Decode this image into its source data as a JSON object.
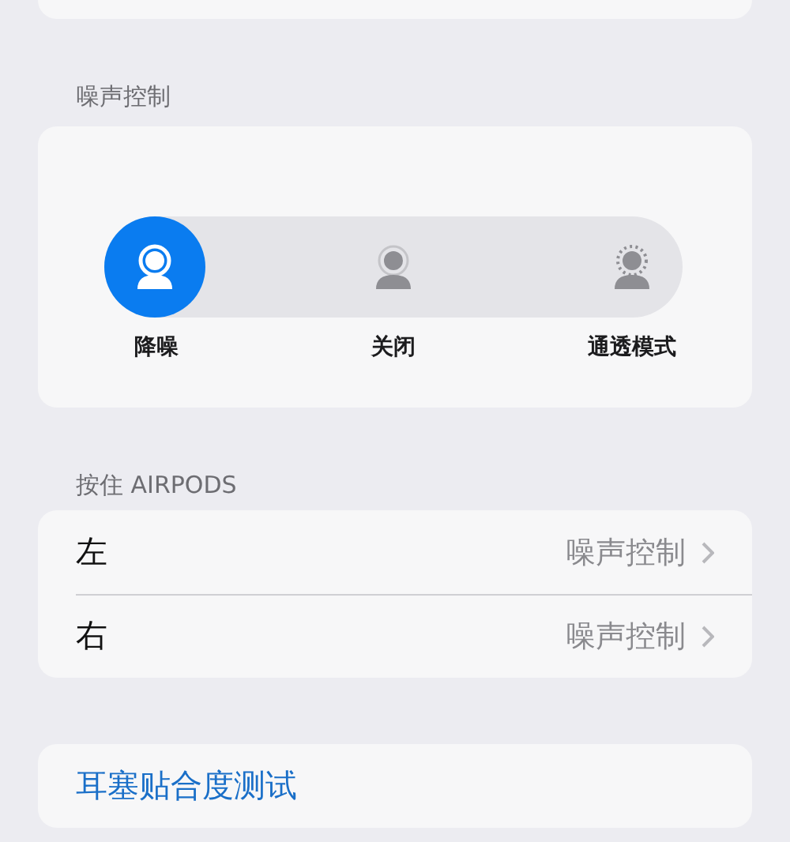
{
  "noise_control": {
    "header": "噪声控制",
    "modes": [
      {
        "kind": "cancel",
        "label": "降噪",
        "selected": true
      },
      {
        "kind": "off",
        "label": "关闭",
        "selected": false
      },
      {
        "kind": "transparency",
        "label": "通透模式",
        "selected": false
      }
    ]
  },
  "press_and_hold": {
    "header": "按住 AIRPODS",
    "rows": [
      {
        "label": "左",
        "value": "噪声控制"
      },
      {
        "label": "右",
        "value": "噪声控制"
      }
    ]
  },
  "fit_test": {
    "label": "耳塞贴合度测试"
  }
}
